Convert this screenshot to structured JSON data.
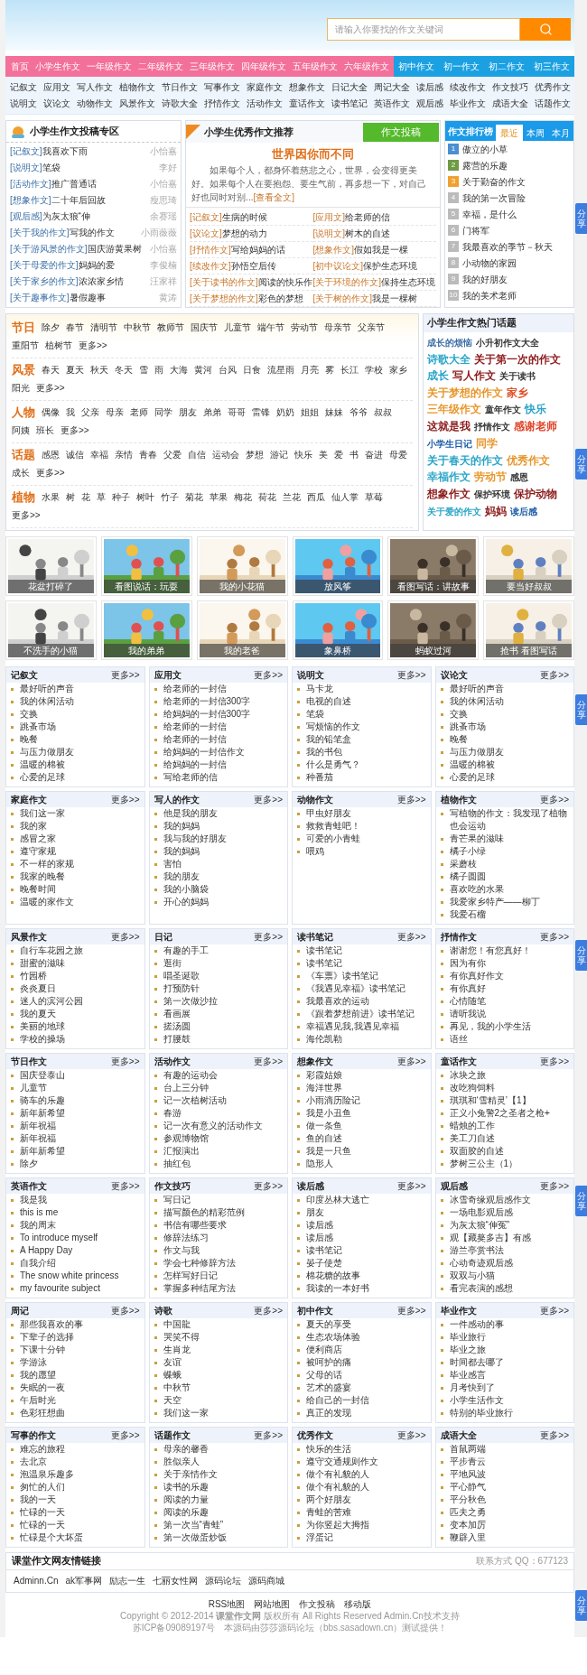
{
  "search": {
    "placeholder": "请输入你要找的作文关键词"
  },
  "nav": {
    "primary": [
      "首页",
      "小学生作文",
      "一年级作文",
      "二年级作文",
      "三年级作文",
      "四年级作文",
      "五年级作文",
      "六年级作文"
    ],
    "junior": [
      "初中作文",
      "初一作文",
      "初二作文",
      "初三作文"
    ]
  },
  "subnav": [
    [
      "记叙文",
      "应用文",
      "写人作文",
      "植物作文",
      "节日作文",
      "写事作文",
      "家庭作文",
      "想象作文",
      "日记大全",
      "周记大全",
      "读后感",
      "续改作文",
      "作文技巧",
      "优秀作文"
    ],
    [
      "说明文",
      "议论文",
      "动物作文",
      "风景作文",
      "诗歌大全",
      "抒情作文",
      "活动作文",
      "童话作文",
      "读书笔记",
      "英语作文",
      "观后感",
      "毕业作文",
      "成语大全",
      "话题作文"
    ]
  ],
  "submissions": {
    "title": "小学生作文投稿专区",
    "items": [
      {
        "category": "[记叙文]",
        "title": "我喜欢下雨",
        "author": "小怡嘉"
      },
      {
        "category": "[说明文]",
        "title": "笔袋",
        "author": "李好"
      },
      {
        "category": "[活动作文]",
        "title": "推广普通话",
        "author": "小怡嘉"
      },
      {
        "category": "[想象作文]",
        "title": "二十年后回故",
        "author": "瘦思琦"
      },
      {
        "category": "[观后感]",
        "title": "为灰太狼“伸",
        "author": "余赛瑶"
      },
      {
        "category": "[关于我的作文]",
        "title": "写我的作文",
        "author": "小雨薇薇"
      },
      {
        "category": "[关于游风景的作文]",
        "title": "国庆游黄果树",
        "author": "小怡嘉"
      },
      {
        "category": "[关于母爱的作文]",
        "title": "妈妈的爱",
        "author": "李俊楠"
      },
      {
        "category": "[关于家乡的作文]",
        "title": "浓浓家乡情",
        "author": "汪家祥"
      },
      {
        "category": "[关于趣事作文]",
        "title": "暑假趣事",
        "author": "黄涛"
      }
    ]
  },
  "recommend": {
    "title": "小学生优秀作文推荐",
    "button": "作文投稿",
    "featured": {
      "title": "世界因你而不同",
      "text": "如果每个人，都身怀着慈悲之心，世界，会变得更美好。如果每个人在要抱怨、要生气前，再多想一下，对自己好也同时对别...",
      "link": "[查看全文]"
    },
    "items": [
      {
        "category": "[记叙文]",
        "title": "生病的时候"
      },
      {
        "category": "[应用文]",
        "title": "给老师的信"
      },
      {
        "category": "[议论文]",
        "title": "梦想的动力"
      },
      {
        "category": "[说明文]",
        "title": "树木的自述"
      },
      {
        "category": "[抒情作文]",
        "title": "写给妈妈的话"
      },
      {
        "category": "[想象作文]",
        "title": "假如我是一棵"
      },
      {
        "category": "[续改作文]",
        "title": "孙悟空后传"
      },
      {
        "category": "[初中议论文]",
        "title": "保护生态环境"
      },
      {
        "category": "[关于读书的作文]",
        "title": "阅读的快乐作"
      },
      {
        "category": "[关于环境的作文]",
        "title": "保持生态环境"
      },
      {
        "category": "[关于梦想的作文]",
        "title": "彩色的梦想"
      },
      {
        "category": "[关于树的作文]",
        "title": "我是一棵树"
      }
    ]
  },
  "ranking": {
    "title": "作文排行榜",
    "tabs": [
      {
        "label": "最近",
        "selected": true
      },
      {
        "label": "本周",
        "selected": false
      },
      {
        "label": "本月",
        "selected": false
      }
    ],
    "items": [
      {
        "rank": "1",
        "title": "傲立的小草",
        "color": "#4a8fd0"
      },
      {
        "rank": "2",
        "title": "露营的乐趣",
        "color": "#6f9a45"
      },
      {
        "rank": "3",
        "title": "关于勤奋的作文",
        "color": "#f0a030"
      },
      {
        "rank": "4",
        "title": "我的第一次冒险",
        "color": "#bbbbbb"
      },
      {
        "rank": "5",
        "title": "幸福，是什么",
        "color": "#bbbbbb"
      },
      {
        "rank": "6",
        "title": "门将军",
        "color": "#bbbbbb"
      },
      {
        "rank": "7",
        "title": "我最喜欢的季节－秋天",
        "color": "#bbbbbb"
      },
      {
        "rank": "8",
        "title": "小动物的家园",
        "color": "#bbbbbb"
      },
      {
        "rank": "9",
        "title": "我的好朋友",
        "color": "#bbbbbb"
      },
      {
        "rank": "10",
        "title": "我的美术老师",
        "color": "#bbbbbb"
      }
    ]
  },
  "tag_groups": [
    {
      "label": "节日",
      "tags": [
        "除夕",
        "春节",
        "清明节",
        "中秋节",
        "教师节",
        "国庆节",
        "儿童节",
        "端午节",
        "劳动节",
        "母亲节",
        "父亲节",
        "重阳节",
        "植树节",
        "更多>>"
      ]
    },
    {
      "label": "风景",
      "tags": [
        "春天",
        "夏天",
        "秋天",
        "冬天",
        "雪",
        "雨",
        "大海",
        "黄河",
        "台风",
        "日食",
        "流星雨",
        "月亮",
        "雾",
        "长江",
        "学校",
        "家乡",
        "阳光",
        "更多>>"
      ]
    },
    {
      "label": "人物",
      "tags": [
        "偶像",
        "我",
        "父亲",
        "母亲",
        "老师",
        "同学",
        "朋友",
        "弟弟",
        "哥哥",
        "雷锋",
        "奶奶",
        "姐姐",
        "妹妹",
        "爷爷",
        "叔叔",
        "阿姨",
        "班长",
        "更多>>"
      ]
    },
    {
      "label": "话题",
      "tags": [
        "感恩",
        "诚信",
        "幸福",
        "亲情",
        "青春",
        "父爱",
        "自信",
        "运动会",
        "梦想",
        "游记",
        "快乐",
        "美",
        "爱",
        "书",
        "奋进",
        "母爱",
        "成长",
        "更多>>"
      ]
    },
    {
      "label": "植物",
      "tags": [
        "水果",
        "树",
        "花",
        "草",
        "种子",
        "树叶",
        "竹子",
        "菊花",
        "苹果",
        "梅花",
        "荷花",
        "兰花",
        "西瓜",
        "仙人掌",
        "草莓",
        "更多>>"
      ]
    }
  ],
  "hot_topics": {
    "title": "小学生作文热门话题",
    "items": [
      {
        "text": "成长的烦恼",
        "color": "#3a6ea5",
        "kind": "small"
      },
      {
        "text": "小升初作文大全",
        "color": "#333333",
        "kind": "small"
      },
      {
        "text": "诗歌大全",
        "color": "#2aa5c8",
        "kind": "big"
      },
      {
        "text": "关于第一次的作文",
        "color": "#8b1a1a",
        "kind": "big"
      },
      {
        "text": "成长",
        "color": "#2aa5c8",
        "kind": "big"
      },
      {
        "text": "写人作文",
        "color": "#8b1a1a",
        "kind": "big"
      },
      {
        "text": "关于读书",
        "color": "#333333",
        "kind": "small"
      },
      {
        "text": "关于梦想的作文",
        "color": "#e8962a",
        "kind": "big"
      },
      {
        "text": "家乡",
        "color": "#e0502a",
        "kind": "big"
      },
      {
        "text": "三年级作文",
        "color": "#e8962a",
        "kind": "big"
      },
      {
        "text": "童年作文",
        "color": "#333333",
        "kind": "small"
      },
      {
        "text": "快乐",
        "color": "#2aa5c8",
        "kind": "big"
      },
      {
        "text": "这就是我",
        "color": "#8b1a1a",
        "kind": "big"
      },
      {
        "text": "抒情作文",
        "color": "#333333",
        "kind": "small"
      },
      {
        "text": "感谢老师",
        "color": "#e0442a",
        "kind": "big"
      },
      {
        "text": "小学生日记",
        "color": "#1a5aa5",
        "kind": "small"
      },
      {
        "text": "同学",
        "color": "#e8962a",
        "kind": "big"
      },
      {
        "text": "关于春天的作文",
        "color": "#2aa5c8",
        "kind": "big"
      },
      {
        "text": "优秀作文",
        "color": "#e8962a",
        "kind": "big"
      },
      {
        "text": "幸福作文",
        "color": "#2aa5c8",
        "kind": "big"
      },
      {
        "text": "劳动节",
        "color": "#e8962a",
        "kind": "big"
      },
      {
        "text": "感恩",
        "color": "#333333",
        "kind": "small"
      },
      {
        "text": "想象作文",
        "color": "#8b1a1a",
        "kind": "big"
      },
      {
        "text": "保护环境",
        "color": "#333333",
        "kind": "small"
      },
      {
        "text": "保护动物",
        "color": "#8b1a1a",
        "kind": "big"
      },
      {
        "text": "关于爱的作文",
        "color": "#2aa5c8",
        "kind": "small"
      },
      {
        "text": "妈妈",
        "color": "#8b1a1a",
        "kind": "big"
      },
      {
        "text": "读后感",
        "color": "#1a5aa5",
        "kind": "small"
      }
    ]
  },
  "pictures": [
    {
      "caption": "花盆打碎了"
    },
    {
      "caption": "看图说话：玩耍"
    },
    {
      "caption": "我的小花猫"
    },
    {
      "caption": "放风筝"
    },
    {
      "caption": "看图写话：讲故事"
    },
    {
      "caption": "要当好叔叔"
    },
    {
      "caption": "不洗手的小猫"
    },
    {
      "caption": "我的弟弟"
    },
    {
      "caption": "我的老爸"
    },
    {
      "caption": "象鼻桥"
    },
    {
      "caption": "蚂蚁过河"
    },
    {
      "caption": "抢书 看图写话"
    }
  ],
  "sections": [
    {
      "title": "记叙文",
      "more": "更多>>",
      "items": [
        "最好听的声音",
        "我的休闲活动",
        "交换",
        "跳蚤市场",
        "晚餐",
        "与压力做朋友",
        "温暖的棉被",
        "心爱的足球"
      ]
    },
    {
      "title": "应用文",
      "more": "更多>>",
      "items": [
        "给老师的一封信",
        "给老师的一封信300字",
        "给妈妈的一封信300字",
        "给老师的一封信",
        "给老师的一封信",
        "给妈妈的一封信作文",
        "给妈妈的一封信",
        "写给老师的信"
      ]
    },
    {
      "title": "说明文",
      "more": "更多>>",
      "items": [
        "马卡龙",
        "电视的自述",
        "笔袋",
        "写烦恼的作文",
        "我的铅笔盒",
        "我的书包",
        "什么是勇气？",
        "种番茄"
      ]
    },
    {
      "title": "议论文",
      "more": "更多>>",
      "items": [
        "最好听的声音",
        "我的休闲活动",
        "交换",
        "跳蚤市场",
        "晚餐",
        "与压力做朋友",
        "温暖的棉被",
        "心爱的足球"
      ]
    },
    {
      "title": "家庭作文",
      "more": "更多>>",
      "items": [
        "我们这一家",
        "我的家",
        "感冒之家",
        "遵守家规",
        "不一样的家规",
        "我家的晚餐",
        "晚餐时间",
        "温暖的家作文"
      ]
    },
    {
      "title": "写人的作文",
      "more": "更多>>",
      "items": [
        "他是我的朋友",
        "我的妈妈",
        "我与我的好朋友",
        "我的妈妈",
        "害怕",
        "我的朋友",
        "我的小脑袋",
        "开心的妈妈"
      ]
    },
    {
      "title": "动物作文",
      "more": "更多>>",
      "items": [
        "甲虫好朋友",
        "救救青蛙吧！",
        "可爱的小青蛙",
        "喂鸡"
      ]
    },
    {
      "title": "植物作文",
      "more": "更多>>",
      "items": [
        "写植物的作文：我发现了植物也会运动",
        "青芒果的滋味",
        "橘子小绿",
        "采蘑枝",
        "橘子圆圆",
        "喜欢吃的水果",
        "我爱家乡特产——柳丁",
        "我爱石榴"
      ]
    },
    {
      "title": "风景作文",
      "more": "更多>>",
      "items": [
        "自行车花园之旅",
        "甜蜜的滋味",
        "竹园桥",
        "炎炎夏日",
        "迷人的滨河公园",
        "我的夏天",
        "美丽的地球",
        "学校的操场"
      ]
    },
    {
      "title": "日记",
      "more": "更多>>",
      "items": [
        "有趣的手工",
        "逛街",
        "唱圣诞歌",
        "打预防针",
        "第一次做沙拉",
        "看画展",
        "搓汤圆",
        "打腰鼓"
      ]
    },
    {
      "title": "读书笔记",
      "more": "更多>>",
      "items": [
        "读书笔记",
        "读书笔记",
        "《车票》读书笔记",
        "《我遇见幸福》读书笔记",
        "我最喜欢的运动",
        "《跟着梦想前进》读书笔记",
        "幸福遇见我,我遇见幸福",
        "海伦凯勒"
      ]
    },
    {
      "title": "抒情作文",
      "more": "更多>>",
      "items": [
        "谢谢您！有您真好！",
        "因为有你",
        "有你真好作文",
        "有你真好",
        "心情随笔",
        "请听我说",
        "再见，我的小学生活",
        "语丝"
      ]
    },
    {
      "title": "节日作文",
      "more": "更多>>",
      "items": [
        "国庆登泰山",
        "儿童节",
        "骑车的乐趣",
        "新年新希望",
        "新年祝福",
        "新年祝福",
        "新年新希望",
        "除夕"
      ]
    },
    {
      "title": "活动作文",
      "more": "更多>>",
      "items": [
        "有趣的运动会",
        "台上三分钟",
        "记一次植树活动",
        "春游",
        "记一次有意义的活动作文",
        "参观博物馆",
        "汇报演出",
        "抽红包"
      ]
    },
    {
      "title": "想象作文",
      "more": "更多>>",
      "items": [
        "彩霞姑娘",
        "海洋世界",
        "小雨滴历险记",
        "我是小丑鱼",
        "做一条鱼",
        "鱼的自述",
        "我是一只鱼",
        "隐形人"
      ]
    },
    {
      "title": "童话作文",
      "more": "更多>>",
      "items": [
        "冰块之旅",
        "改吃狗饲料",
        "琪琪和‘雪精灵’【1】",
        "正义小兔警2之圣者之枪+",
        "蜡烛的工作",
        "美工刀自述",
        "双面胶的自述",
        "梦树三公主（1）"
      ]
    },
    {
      "title": "英语作文",
      "more": "更多>>",
      "items": [
        "我是我",
        "this is me",
        "我的周末",
        "To introduce myself",
        "A Happy Day",
        "自我介绍",
        "The snow white princess",
        "my favourite subject"
      ]
    },
    {
      "title": "作文技巧",
      "more": "更多>>",
      "items": [
        "写日记",
        "描写颜色的精彩范例",
        "书信有哪些要求",
        "修辞法练习",
        "作文与我",
        "学会七种修辞方法",
        "怎样写好日记",
        "掌握多种结尾方法"
      ]
    },
    {
      "title": "读后感",
      "more": "更多>>",
      "items": [
        "印度丛林大逃亡",
        "朋友",
        "读后感",
        "读后感",
        "读书笔记",
        "晏子使楚",
        "棉花糖的故事",
        "我读的一本好书"
      ]
    },
    {
      "title": "观后感",
      "more": "更多>>",
      "items": [
        "冰雪奇缘观后感作文",
        "一场电影观后感",
        "为灰太狼“伸冤”",
        "观【藏獒多吉】有感",
        "游兰亭赏书法",
        "心动奇迹观后感",
        "双双与小猫",
        "看完表演的感想"
      ]
    },
    {
      "title": "周记",
      "more": "更多>>",
      "items": [
        "那些我喜欢的事",
        "下辈子的选择",
        "下课十分钟",
        "学游泳",
        "我的愿望",
        "失眠的一夜",
        "午后时光",
        "色彩狂想曲"
      ]
    },
    {
      "title": "诗歌",
      "more": "更多>>",
      "items": [
        "中国龍",
        "哭笑不得",
        "生肖龙",
        "友谊",
        "蝶蛾",
        "中秋节",
        "天空",
        "我们这一家"
      ]
    },
    {
      "title": "初中作文",
      "more": "更多>>",
      "items": [
        "夏天的享受",
        "生态农场体验",
        "便利商店",
        "被呵护的痛",
        "父母的话",
        "艺术的盛宴",
        "给自己的一封信",
        "真正的发现"
      ]
    },
    {
      "title": "毕业作文",
      "more": "更多>>",
      "items": [
        "一件感动的事",
        "毕业旅行",
        "毕业之旅",
        "时间都去哪了",
        "毕业感言",
        "月考快到了",
        "小学生活作文",
        "特别的毕业旅行"
      ]
    },
    {
      "title": "写事的作文",
      "more": "更多>>",
      "items": [
        "难忘的旅程",
        "去北京",
        "泡温泉乐趣多",
        "匆忙的人们",
        "我的一天",
        "忙碌的一天",
        "忙碌的一天",
        "忙碌是个大坏蛋"
      ]
    },
    {
      "title": "话题作文",
      "more": "更多>>",
      "items": [
        "母亲的馨香",
        "胜似亲人",
        "关于亲情作文",
        "读书的乐趣",
        "阅读的力量",
        "阅读的乐趣",
        "第一次当“青蛙”",
        "第一次做蛋炒饭"
      ]
    },
    {
      "title": "优秀作文",
      "more": "更多>>",
      "items": [
        "快乐的生活",
        "遵守交通规则作文",
        "做个有礼貌的人",
        "做个有礼貌的人",
        "两个好朋友",
        "青蛙的苦难",
        "为你竖起大拇指",
        "浮蛋记"
      ]
    },
    {
      "title": "成语大全",
      "more": "更多>>",
      "items": [
        "首鼠两端",
        "平步青云",
        "平地风波",
        "平心静气",
        "平分秋色",
        "匹夫之勇",
        "变本加厉",
        "鞭辟入里"
      ]
    }
  ],
  "friend_links": {
    "title": "课堂作文网友情链接",
    "contact": "联系方式 QQ：677123",
    "links": [
      "Adminn.Cn",
      "ak军事网",
      "励志一生",
      "七丽女性网",
      "源码论坛",
      "源码商城"
    ]
  },
  "footer": {
    "links": [
      "RSS地图",
      "网站地图",
      "作文投稿",
      "移动版"
    ],
    "copyright": "Copyright © 2012-2014 **课堂作文网** 版权所有 All Rights Reserved Admin.Cn技术支持",
    "icp": "苏ICP备09089197号　本源码由莎莎源码论坛（bbs.sasadown.cn）测试提供！"
  },
  "share_tabs": [
    "分享",
    "分享",
    "分享",
    "分享",
    "分享",
    "分享"
  ]
}
